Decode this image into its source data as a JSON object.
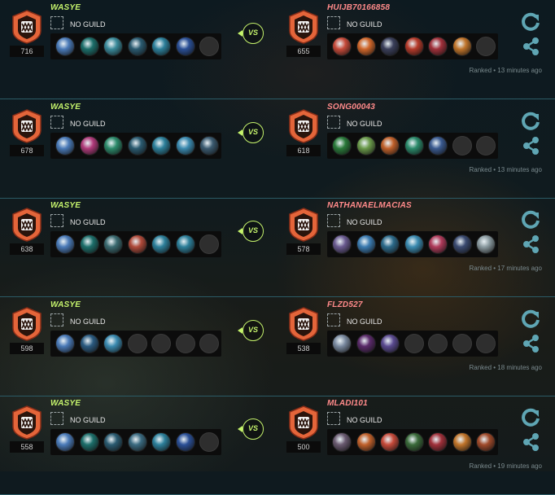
{
  "labels": {
    "vs": "VS",
    "no_guild": "NO GUILD"
  },
  "colors": {
    "accent": "#c5f36c",
    "opponent": "#ff8a8a",
    "icon": "#5fa6b4",
    "badge": "#e4653a"
  },
  "icons": {
    "rank": "rank-badge-icon",
    "replay": "replay-icon",
    "share": "share-icon"
  },
  "matches": [
    {
      "left": {
        "name": "WASYE",
        "guild": "NO GUILD",
        "elo": "716",
        "heroes": [
          "#4a7ab8",
          "#1c6e6a",
          "#3a8a9a",
          "#2a5a70",
          "#2c7f9a",
          "#2a4f96",
          "empty"
        ]
      },
      "right": {
        "name": "HUIJB70166858",
        "guild": "NO GUILD",
        "elo": "655",
        "heroes": [
          "#c64a3a",
          "#d0662a",
          "#3a3f5a",
          "#b53a2a",
          "#a0303a",
          "#c0742a",
          "empty"
        ]
      },
      "meta": "Ranked • 13 minutes ago"
    },
    {
      "left": {
        "name": "WASYE",
        "guild": "NO GUILD",
        "elo": "678",
        "heroes": [
          "#4a7ab8",
          "#b03a7a",
          "#2c8a6a",
          "#2a5a70",
          "#2c7f9a",
          "#3a8ab0",
          "#3a5a70"
        ]
      },
      "right": {
        "name": "SONG00043",
        "guild": "NO GUILD",
        "elo": "618",
        "heroes": [
          "#2a7a3a",
          "#6a9a4a",
          "#c0602a",
          "#2a8a6a",
          "#3a5a90",
          "empty",
          "empty"
        ]
      },
      "meta": "Ranked • 13 minutes ago"
    },
    {
      "left": {
        "name": "WASYE",
        "guild": "NO GUILD",
        "elo": "638",
        "heroes": [
          "#4a7ab8",
          "#1c6e6a",
          "#3a6a70",
          "#b04a3a",
          "#2c7f9a",
          "#2c7f9a",
          "empty"
        ]
      },
      "right": {
        "name": "NATHANAELMACIAS",
        "guild": "NO GUILD",
        "elo": "578",
        "heroes": [
          "#6a5a90",
          "#3a7ab0",
          "#2c6a8a",
          "#3a8ab0",
          "#b03a5a",
          "#3a4a70",
          "#8a9aa0"
        ]
      },
      "meta": "Ranked • 17 minutes ago"
    },
    {
      "left": {
        "name": "WASYE",
        "guild": "NO GUILD",
        "elo": "598",
        "heroes": [
          "#4a7ab8",
          "#2a5a80",
          "#3a8ab0",
          "empty",
          "empty",
          "empty",
          "empty"
        ]
      },
      "right": {
        "name": "FLZD527",
        "guild": "NO GUILD",
        "elo": "538",
        "heroes": [
          "#7a8aa0",
          "#5a2a6a",
          "#5a4a90",
          "empty",
          "empty",
          "empty",
          "empty"
        ]
      },
      "meta": "Ranked • 18 minutes ago"
    },
    {
      "left": {
        "name": "WASYE",
        "guild": "NO GUILD",
        "elo": "558",
        "heroes": [
          "#4a7ab8",
          "#1c6e6a",
          "#2a5a70",
          "#3a6a80",
          "#2c7f9a",
          "#2a4f96",
          "empty"
        ]
      },
      "right": {
        "name": "MLADI101",
        "guild": "NO GUILD",
        "elo": "500",
        "heroes": [
          "#6a5a70",
          "#c0602a",
          "#c64a3a",
          "#3a6a3a",
          "#a0303a",
          "#c0742a",
          "#a04a2a"
        ]
      },
      "meta": "Ranked • 19 minutes ago"
    }
  ]
}
